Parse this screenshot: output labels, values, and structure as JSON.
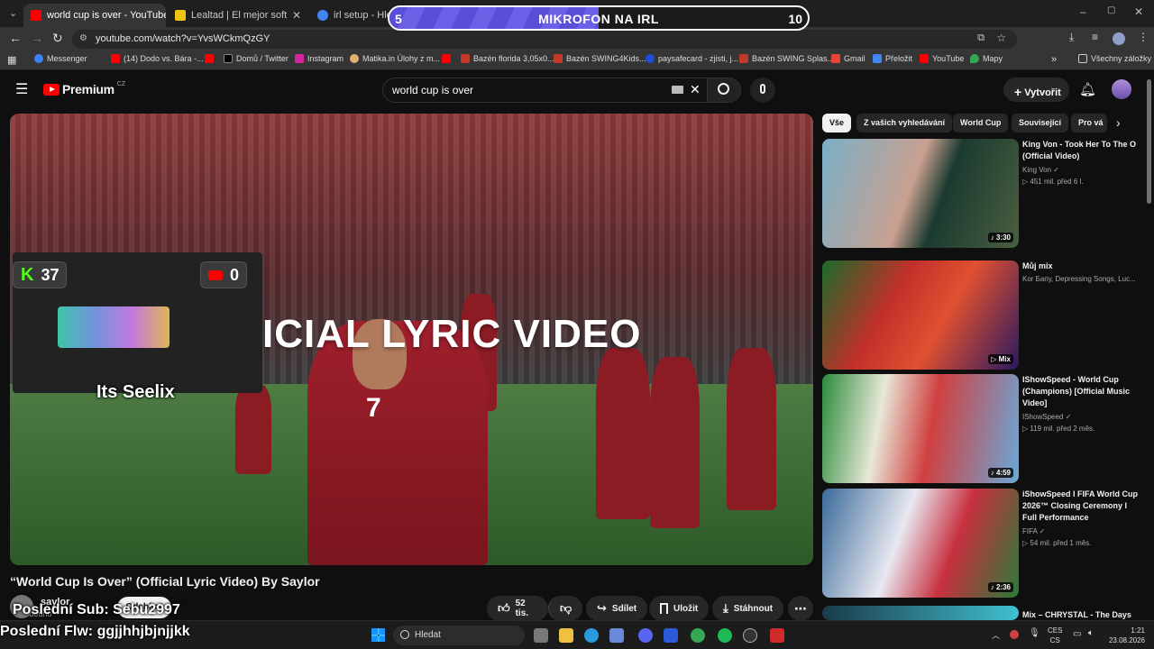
{
  "browser": {
    "tabs": [
      {
        "title": "world cup is over - YouTube",
        "fav_color": "#ff0000"
      },
      {
        "title": "Lealtad | El mejor software para",
        "fav_color": "#f1c40f"
      },
      {
        "title": "irl setup - Hledat G",
        "fav_color": "#4285f4"
      }
    ],
    "url": "youtube.com/watch?v=YvsWCkmQzGY",
    "bookmarks": [
      {
        "label": "Messenger"
      },
      {
        "label": "(14) Dodo vs. Bára -..."
      },
      {
        "label": ""
      },
      {
        "label": "Domů / Twitter"
      },
      {
        "label": "Instagram"
      },
      {
        "label": "Matika.in Úlohy z m..."
      },
      {
        "label": ""
      },
      {
        "label": "Bazén florida 3,05x0..."
      },
      {
        "label": "Bazén SWING4Kids..."
      },
      {
        "label": "paysafecard - zjisti, j..."
      },
      {
        "label": "Bazén SWING Splas..."
      },
      {
        "label": "Gmail"
      },
      {
        "label": "Přeložit"
      },
      {
        "label": "YouTube"
      },
      {
        "label": "Mapy"
      }
    ],
    "all_bookmarks": "Všechny záložky",
    "window_controls": {
      "minimize": "–",
      "maximize": "▢",
      "close": "✕"
    }
  },
  "overlay": {
    "goal_left": "5",
    "goal_label": "MIKROFON NA IRL",
    "goal_right": "10",
    "goal_progress": 0.5,
    "kick_count": "37",
    "yt_count": "0",
    "cam_name": "Its Seelix",
    "last_sub": "Poslední Sub: Sebu2997",
    "last_flw": "Poslední Flw: ggjjhhjbjnjjkk"
  },
  "youtube": {
    "logo_text": "Premium",
    "logo_region": "CZ",
    "search_query": "world cup is over",
    "create_label": "Vytvořit",
    "video_overlay_text": "ICIAL LYRIC VIDEO",
    "player_number": "7",
    "video_title": "“World Cup Is Over” (Official Lyric Video) By Saylor",
    "channel": "saylor",
    "subs_text": "Jedno",
    "subscribe_label": "Odebírat",
    "likes": "52 tis.",
    "share_label": "Sdílet",
    "save_label": "Uložit",
    "download_label": "Stáhnout",
    "chips": [
      "Vše",
      "Z vašich vyhledávání",
      "World Cup",
      "Související",
      "Pro vá"
    ],
    "recommendations": [
      {
        "title": "King Von - Took Her To The O (Official Video)",
        "channel": "King Von ✓",
        "meta": "▷ 451 mil.   před 6 l.",
        "duration": "♪ 3:30"
      },
      {
        "title": "Můj mix",
        "channel": "Kor Бапу, Depressing Songs, Luc...",
        "meta": "",
        "duration": "▷ Mix"
      },
      {
        "title": "IShowSpeed - World Cup (Champions) [Official Music Video]",
        "channel": "IShowSpeed ✓",
        "meta": "▷ 119 mil.   před 2 měs.",
        "duration": "♪ 4:59"
      },
      {
        "title": "iShowSpeed I FIFA World Cup 2026™ Closing Ceremony I Full Performance",
        "channel": "FIFA ✓",
        "meta": "▷ 54 mil.   před 1 měs.",
        "duration": "♪ 2:36"
      },
      {
        "title": "Mix – CHRYSTAL - The Days",
        "channel": "",
        "meta": "",
        "duration": ""
      }
    ]
  },
  "taskbar": {
    "search": "Hledat",
    "lang_top": "CES",
    "lang_bottom": "CS",
    "time": "1:21",
    "date": "23.08.2026"
  }
}
